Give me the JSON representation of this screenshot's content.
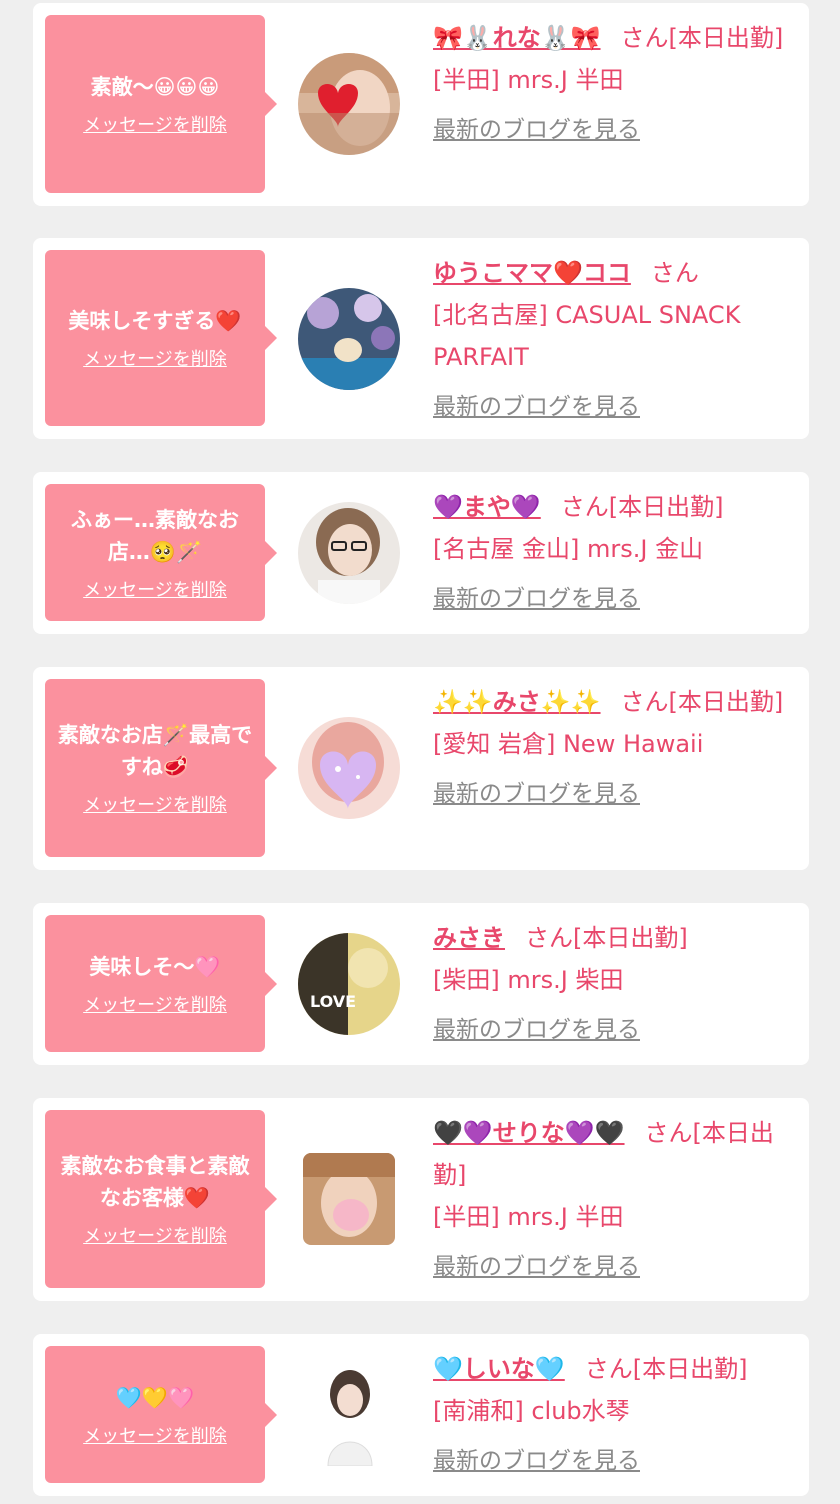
{
  "delete_label": "メッセージを削除",
  "blog_label": "最新のブログを見る",
  "colors": {
    "bubble": "#fb919e",
    "accent": "#e8476b",
    "link_gray": "#8a8a8a",
    "background": "#efefef"
  },
  "messages": [
    {
      "text": "素敵〜😀😀😀",
      "girl_name": "🎀🐰れな🐰🎀",
      "suffix": "さん[本日出勤]",
      "shop": "[半田] mrs.J 半田",
      "avatar_icon": "avatar-photo-heart"
    },
    {
      "text": "美味しそすぎる❤️",
      "girl_name": "ゆうこママ❤️ココ",
      "suffix": "さん",
      "shop": "[北名古屋] CASUAL SNACK PARFAIT",
      "avatar_icon": "avatar-photo-flowers"
    },
    {
      "text": "ふぁー…素敵なお店…🥺🪄",
      "girl_name": "💜まや💜",
      "suffix": "さん[本日出勤]",
      "shop": "[名古屋 金山] mrs.J 金山",
      "avatar_icon": "avatar-photo-glasses"
    },
    {
      "text": "素敵なお店🪄最高ですね🥩",
      "girl_name": "✨✨みさ✨✨",
      "suffix": "さん[本日出勤]",
      "shop": "[愛知 岩倉] New Hawaii",
      "avatar_icon": "avatar-photo-heart-sparkle"
    },
    {
      "text": "美味しそ〜🩷",
      "girl_name": "みさき",
      "suffix": "さん[本日出勤]",
      "shop": "[柴田] mrs.J 柴田",
      "avatar_icon": "avatar-photo-love"
    },
    {
      "text": "素敵なお食事と素敵なお客様❤️",
      "girl_name": "🖤💜せりな💜🖤",
      "suffix": "さん[本日出勤]",
      "shop": "[半田] mrs.J 半田",
      "avatar_icon": "avatar-photo-blur"
    },
    {
      "text": "🩵💛🩷",
      "girl_name": "🩵しいな🩵",
      "suffix": "さん[本日出勤]",
      "shop": "[南浦和] club水琴",
      "avatar_icon": "avatar-photo-pose"
    }
  ]
}
